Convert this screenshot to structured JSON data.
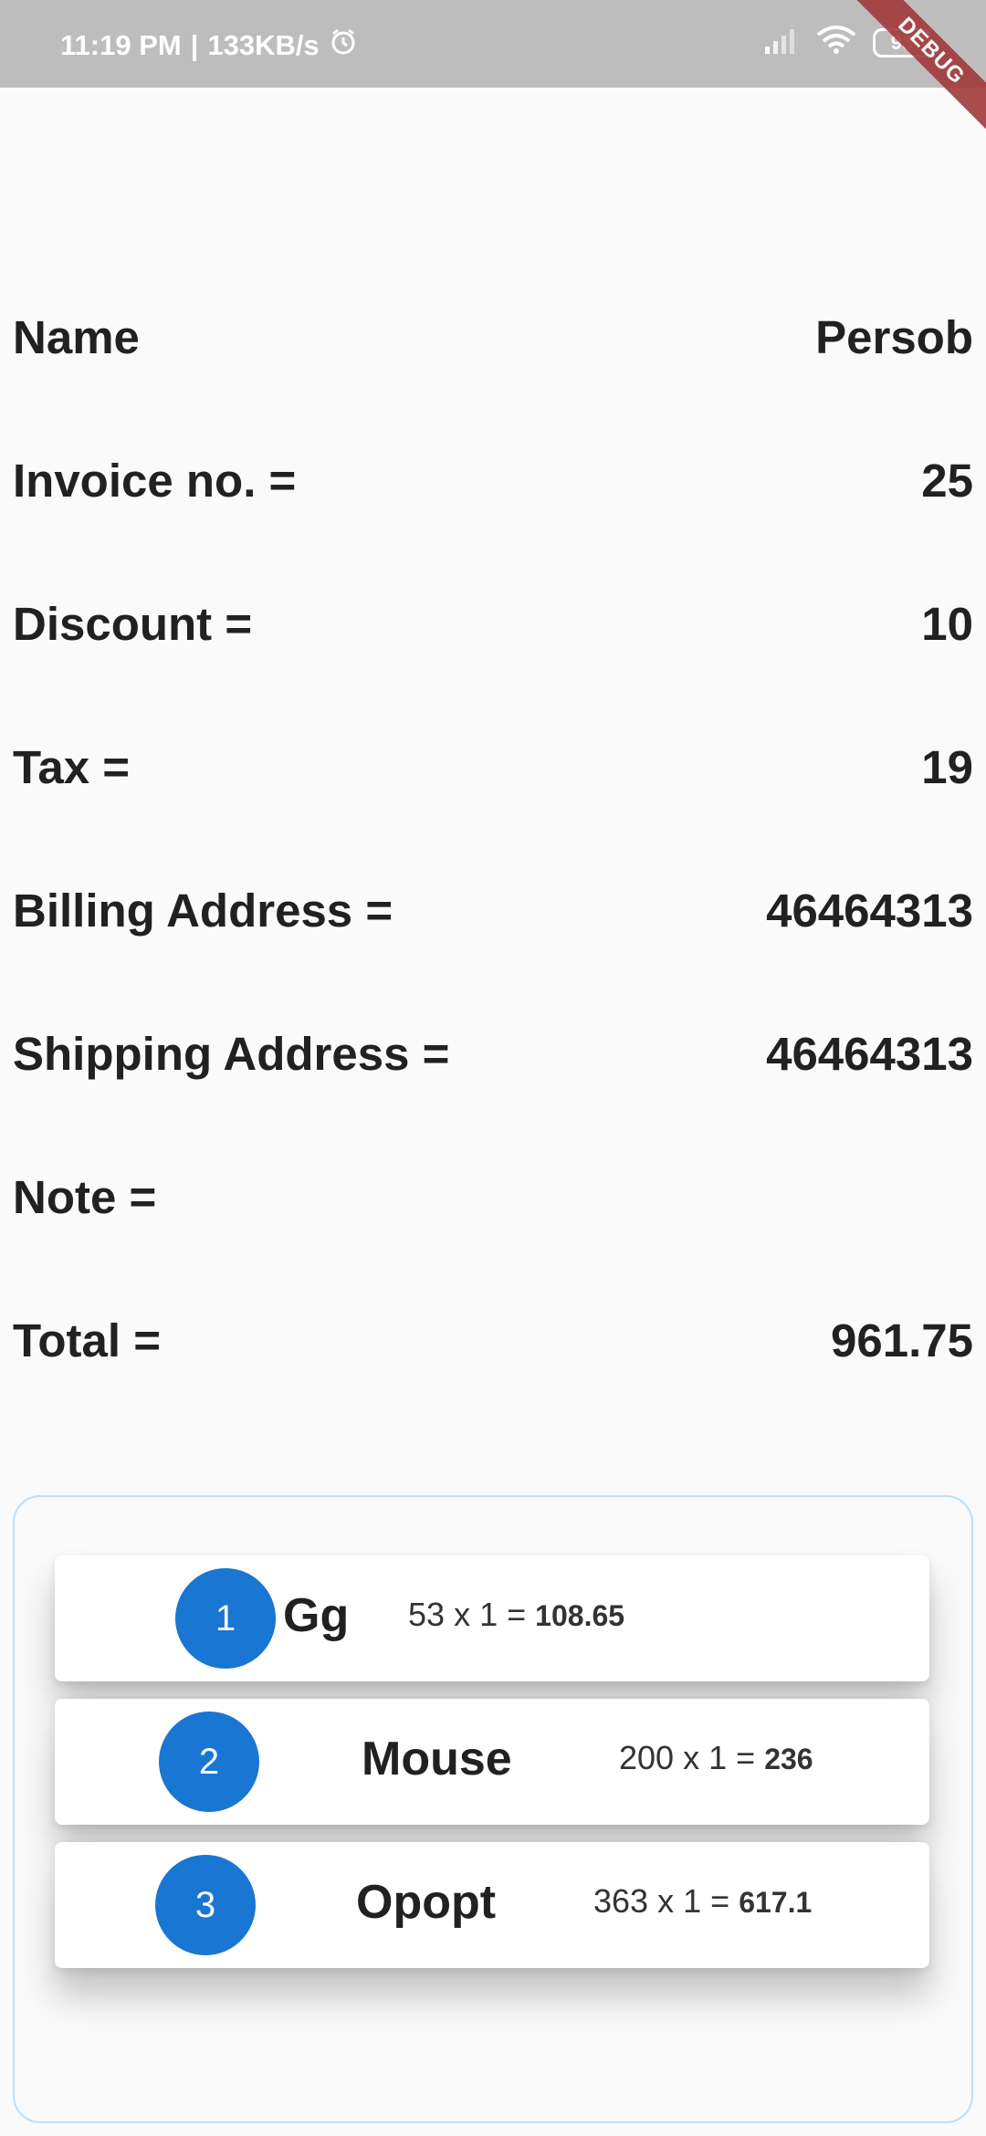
{
  "status_bar": {
    "time": "11:19 PM",
    "separator": "|",
    "speed": "133KB/s",
    "battery": "93",
    "debug": "DEBUG"
  },
  "details": [
    {
      "label": "Name",
      "value": "Persob"
    },
    {
      "label": "Invoice no. =",
      "value": "25"
    },
    {
      "label": "Discount =",
      "value": "10"
    },
    {
      "label": "Tax =",
      "value": "19"
    },
    {
      "label": "Billing Address =",
      "value": "46464313"
    },
    {
      "label": "Shipping Address =",
      "value": "46464313"
    },
    {
      "label": "Note =",
      "value": ""
    },
    {
      "label": "Total =",
      "value": "961.75"
    }
  ],
  "items": [
    {
      "index": "1",
      "name": "Gg",
      "price": "53",
      "x": "x",
      "qty": "1",
      "eq": "=",
      "total": "108.65"
    },
    {
      "index": "2",
      "name": "Mouse",
      "price": "200",
      "x": "x",
      "qty": "1",
      "eq": "=",
      "total": "236"
    },
    {
      "index": "3",
      "name": "Opopt",
      "price": "363",
      "x": "x",
      "qty": "1",
      "eq": "=",
      "total": "617.1"
    }
  ],
  "colors": {
    "accent": "#1976d2",
    "status_bar": "#bdbdbd",
    "panel_border": "#bbdefb"
  }
}
